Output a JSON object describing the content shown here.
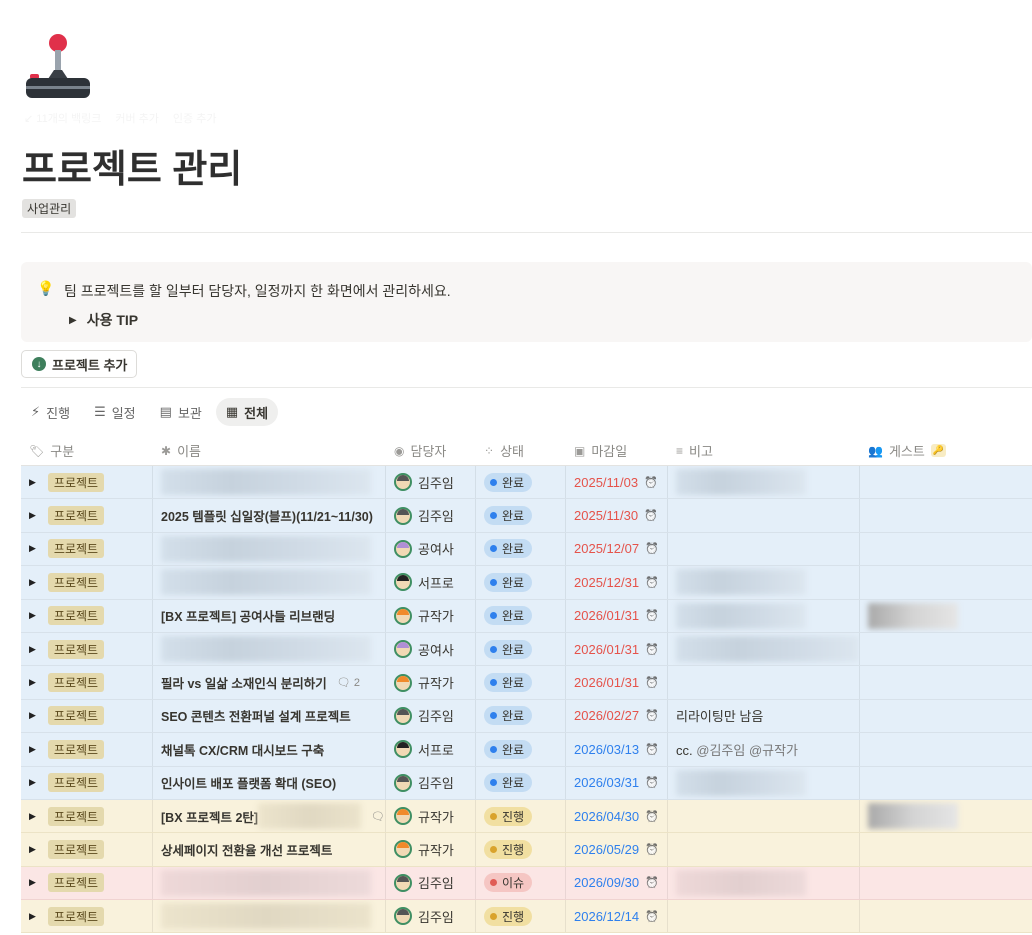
{
  "page": {
    "meta": [
      "↙ 11개의 백링크",
      "커버 추가",
      "인증 추가"
    ],
    "title": "프로젝트 관리",
    "tag": "사업관리",
    "callout": {
      "text": "팀 프로젝트를 할 일부터 담당자, 일정까지 한 화면에서 관리하세요.",
      "toggle": "사용 TIP"
    },
    "add_button": "프로젝트 추가"
  },
  "tabs": [
    {
      "label": "진행",
      "icon": "⚡"
    },
    {
      "label": "일정",
      "icon": "☰"
    },
    {
      "label": "보관",
      "icon": "▤"
    },
    {
      "label": "전체",
      "icon": "▦",
      "active": true
    }
  ],
  "columns": [
    {
      "label": "구분",
      "icon": "🏷"
    },
    {
      "label": "이름",
      "icon": "✱"
    },
    {
      "label": "담당자",
      "icon": "◉"
    },
    {
      "label": "상태",
      "icon": "⁘"
    },
    {
      "label": "마감일",
      "icon": "▣"
    },
    {
      "label": "비고",
      "icon": "≡"
    },
    {
      "label": "게스트",
      "icon": "👥"
    }
  ],
  "status_colors": {
    "완료": {
      "bg": "#c3dcf3",
      "dot": "#2f80ed",
      "row": "s-done"
    },
    "진행": {
      "bg": "#f1dfa1",
      "dot": "#d9a32c",
      "row": "s-prog"
    },
    "이슈": {
      "bg": "#f5c6c3",
      "dot": "#e05c55",
      "row": "s-issue"
    }
  },
  "date_colors": {
    "overdue": "#e5534b",
    "upcoming": "#2f80ed"
  },
  "rows": [
    {
      "type": "프로젝트",
      "name": "",
      "assignee": "김주임",
      "status": "완료",
      "due": "2025/11/03",
      "overdue": true,
      "note": "",
      "noteBlur": true
    },
    {
      "type": "프로젝트",
      "name": "2025 템플릿 십일장(블프)(11/21~11/30)",
      "assignee": "김주임",
      "status": "완료",
      "due": "2025/11/30",
      "overdue": true,
      "note": ""
    },
    {
      "type": "프로젝트",
      "name": "",
      "assignee": "공여사",
      "status": "완료",
      "due": "2025/12/07",
      "overdue": true,
      "note": ""
    },
    {
      "type": "프로젝트",
      "name": "",
      "assignee": "서프로",
      "status": "완료",
      "due": "2025/12/31",
      "overdue": true,
      "note": "",
      "noteBlur": true
    },
    {
      "type": "프로젝트",
      "name": "[BX 프로젝트] 공여사들 리브랜딩",
      "assignee": "규작가",
      "status": "완료",
      "due": "2026/01/31",
      "overdue": true,
      "note": "",
      "noteBlur": true,
      "guestBlur": true
    },
    {
      "type": "프로젝트",
      "name": "",
      "assignee": "공여사",
      "status": "완료",
      "due": "2026/01/31",
      "overdue": true,
      "note": "",
      "noteBlur": true
    },
    {
      "type": "프로젝트",
      "name": "필라 vs 일삶 소재인식 분리하기",
      "comments": "2",
      "assignee": "규작가",
      "status": "완료",
      "due": "2026/01/31",
      "overdue": true,
      "note": ""
    },
    {
      "type": "프로젝트",
      "name": "SEO 콘텐츠 전환퍼널 설계 프로젝트",
      "assignee": "김주임",
      "status": "완료",
      "due": "2026/02/27",
      "overdue": true,
      "note": "리라이팅만 남음"
    },
    {
      "type": "프로젝트",
      "name": "채널톡 CX/CRM 대시보드 구축",
      "assignee": "서프로",
      "status": "완료",
      "due": "2026/03/13",
      "overdue": false,
      "note": "cc.",
      "mentions": "@김주임 @규작가"
    },
    {
      "type": "프로젝트",
      "name": "인사이트 배포 플랫폼 확대 (SEO)",
      "assignee": "김주임",
      "status": "완료",
      "due": "2026/03/31",
      "overdue": false,
      "note": "",
      "noteBlur": true
    },
    {
      "type": "프로젝트",
      "name": "[BX 프로젝트 2탄]",
      "nameBlurTail": true,
      "comments": "",
      "assignee": "규작가",
      "status": "진행",
      "due": "2026/04/30",
      "overdue": false,
      "note": "",
      "guestBlur": true
    },
    {
      "type": "프로젝트",
      "name": "상세페이지 전환율 개선 프로젝트",
      "assignee": "규작가",
      "status": "진행",
      "due": "2026/05/29",
      "overdue": false,
      "note": ""
    },
    {
      "type": "프로젝트",
      "name": "",
      "assignee": "김주임",
      "status": "이슈",
      "due": "2026/09/30",
      "overdue": false,
      "note": "",
      "noteBlur": true
    },
    {
      "type": "프로젝트",
      "name": "",
      "assignee": "김주임",
      "status": "진행",
      "due": "2026/12/14",
      "overdue": false,
      "note": ""
    }
  ]
}
